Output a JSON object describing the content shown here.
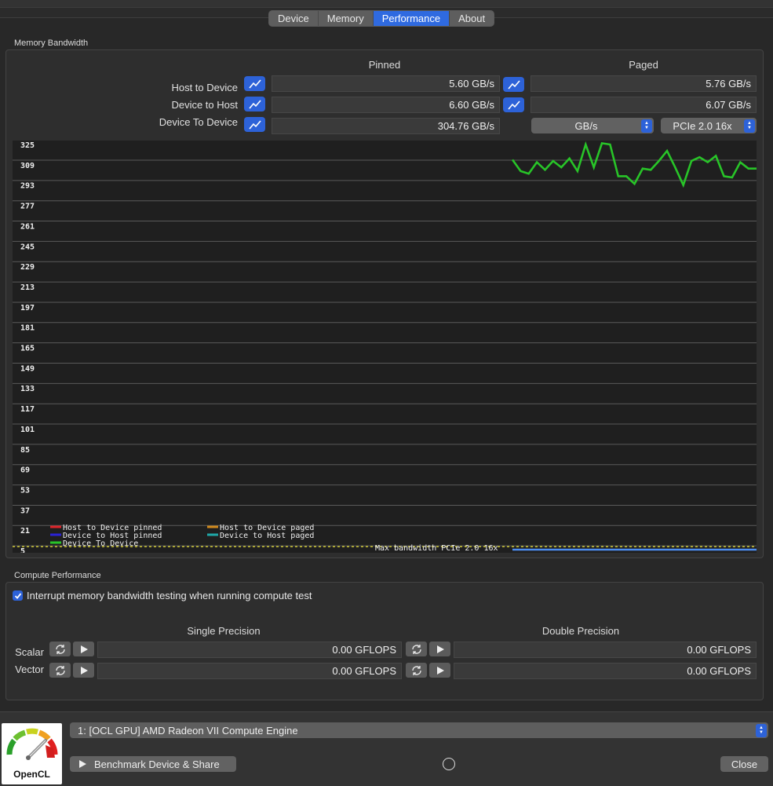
{
  "tabs": [
    {
      "label": "Device",
      "active": false
    },
    {
      "label": "Memory",
      "active": false
    },
    {
      "label": "Performance",
      "active": true
    },
    {
      "label": "About",
      "active": false
    }
  ],
  "memory_bandwidth": {
    "group_label": "Memory Bandwidth",
    "col_pinned": "Pinned",
    "col_paged": "Paged",
    "rows": [
      {
        "label": "Host to Device",
        "pinned": "5.60 GB/s",
        "paged": "5.76 GB/s"
      },
      {
        "label": "Device to Host",
        "pinned": "6.60 GB/s",
        "paged": "6.07 GB/s"
      },
      {
        "label": "Device To Device",
        "pinned": "304.76 GB/s"
      }
    ],
    "unit_popup": "GB/s",
    "bus_popup": "PCIe 2.0 16x",
    "graph_icon": "line-graph-icon"
  },
  "chart_data": {
    "type": "line",
    "yticks": [
      325,
      309,
      293,
      277,
      261,
      245,
      229,
      213,
      197,
      181,
      165,
      149,
      133,
      117,
      101,
      85,
      69,
      53,
      37,
      21,
      5
    ],
    "ylim": [
      5,
      325
    ],
    "legend": [
      {
        "name": "Host to Device pinned",
        "color": "#e0242a"
      },
      {
        "name": "Host to Device paged",
        "color": "#d28a1c"
      },
      {
        "name": "Device to Host pinned",
        "color": "#2a22d6"
      },
      {
        "name": "Device to Host paged",
        "color": "#1fa8a8"
      },
      {
        "name": "Device To Device",
        "color": "#28c428"
      }
    ],
    "max_line_label": "Max bandwidth PCIe 2.0 16x",
    "max_line_value": 8,
    "series": [
      {
        "name": "Device To Device",
        "color": "#28c428",
        "values": [
          313,
          304,
          302,
          311,
          305,
          312,
          307,
          314,
          304,
          325,
          307,
          326,
          325,
          300,
          300,
          294,
          306,
          305,
          312,
          320,
          307,
          293,
          312,
          315,
          311,
          316,
          300,
          299,
          311,
          306,
          306
        ]
      },
      {
        "name": "Host to Device pinned",
        "color": "#4d8df0",
        "values": [
          5.6,
          5.6,
          5.6,
          5.6,
          5.6,
          5.6,
          5.6,
          5.6,
          5.6,
          5.6,
          5.6,
          5.6,
          5.6,
          5.6,
          5.6,
          5.6,
          5.6,
          5.6,
          5.6,
          5.6,
          5.6,
          5.6,
          5.6,
          5.6,
          5.6,
          5.6,
          5.6,
          5.6,
          5.6,
          5.6,
          5.6
        ]
      }
    ]
  },
  "compute": {
    "group_label": "Compute Performance",
    "checkbox_label": "Interrupt memory bandwidth testing when running compute test",
    "checkbox_checked": true,
    "col_single": "Single Precision",
    "col_double": "Double Precision",
    "rows": [
      {
        "label": "Scalar",
        "single": "0.00 GFLOPS",
        "double": "0.00 GFLOPS"
      },
      {
        "label": "Vector",
        "single": "0.00 GFLOPS",
        "double": "0.00 GFLOPS"
      }
    ]
  },
  "bottom": {
    "logo_text": "OpenCL",
    "device_popup": "1: [OCL GPU] AMD Radeon VII Compute Engine",
    "benchmark_button": "Benchmark Device & Share",
    "close_button": "Close"
  }
}
